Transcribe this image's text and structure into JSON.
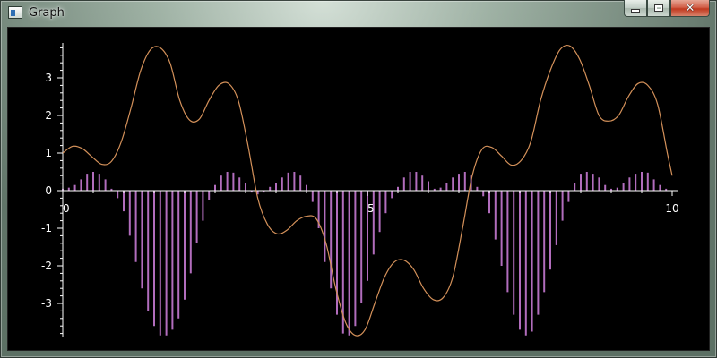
{
  "window": {
    "title": "Graph",
    "icon": "app-window-icon",
    "buttons": {
      "minimize": "minimize-icon",
      "maximize": "maximize-icon",
      "close": "close-icon"
    }
  },
  "colors": {
    "background": "#000000",
    "axis": "#ffffff",
    "line": "#d4915a",
    "bars": "#b26dbd"
  },
  "chart_data": {
    "type": "line",
    "title": "",
    "xlabel": "",
    "ylabel": "",
    "xlim": [
      0,
      10
    ],
    "ylim": [
      -3.9,
      3.9
    ],
    "x_ticks": [
      0,
      5,
      10
    ],
    "x_tick_labels": [
      "0",
      "5",
      "10"
    ],
    "y_ticks": [
      -3,
      -2,
      -1,
      0,
      1,
      2,
      3
    ],
    "y_tick_labels": [
      "-3",
      "-2",
      "-1",
      "0",
      "1",
      "2",
      "3"
    ],
    "grid": false,
    "legend": "none",
    "series": [
      {
        "type": "line",
        "x": [
          0,
          0.16,
          0.32,
          0.48,
          0.64,
          0.8,
          0.96,
          1.12,
          1.28,
          1.44,
          1.6,
          1.76,
          1.92,
          2.08,
          2.24,
          2.4,
          2.56,
          2.72,
          2.88,
          3.04,
          3.2,
          3.36,
          3.52,
          3.68,
          3.84,
          4.0,
          4.16,
          4.32,
          4.48,
          4.64,
          4.8,
          4.96,
          5.12,
          5.28,
          5.44,
          5.6,
          5.76,
          5.92,
          6.08,
          6.24,
          6.4,
          6.56,
          6.72,
          6.88,
          7.04,
          7.2,
          7.36,
          7.52,
          7.68,
          7.84,
          8.0,
          8.16,
          8.32,
          8.48,
          8.64,
          8.8,
          8.96,
          9.12,
          9.28,
          9.44,
          9.6,
          9.76,
          9.92,
          10.0
        ],
        "y": [
          1.0,
          1.18,
          1.12,
          0.9,
          0.7,
          0.78,
          1.3,
          2.2,
          3.2,
          3.75,
          3.8,
          3.4,
          2.4,
          1.88,
          1.9,
          2.4,
          2.8,
          2.85,
          2.4,
          1.2,
          -0.2,
          -0.9,
          -1.15,
          -1.05,
          -0.8,
          -0.68,
          -0.75,
          -1.4,
          -2.6,
          -3.5,
          -3.85,
          -3.7,
          -3.0,
          -2.3,
          -1.9,
          -1.85,
          -2.1,
          -2.6,
          -2.9,
          -2.85,
          -2.3,
          -1.0,
          0.4,
          1.1,
          1.15,
          0.92,
          0.68,
          0.8,
          1.3,
          2.4,
          3.2,
          3.75,
          3.85,
          3.5,
          2.8,
          2.0,
          1.85,
          2.0,
          2.5,
          2.85,
          2.8,
          2.3,
          1.0,
          0.4
        ]
      },
      {
        "type": "bar",
        "x": [
          0.0,
          0.1,
          0.2,
          0.3,
          0.4,
          0.5,
          0.6,
          0.7,
          0.8,
          0.9,
          1.0,
          1.1,
          1.2,
          1.3,
          1.4,
          1.5,
          1.6,
          1.7,
          1.8,
          1.9,
          2.0,
          2.1,
          2.2,
          2.3,
          2.4,
          2.5,
          2.6,
          2.7,
          2.8,
          2.9,
          3.0,
          3.1,
          3.2,
          3.3,
          3.4,
          3.5,
          3.6,
          3.7,
          3.8,
          3.9,
          4.0,
          4.1,
          4.2,
          4.3,
          4.4,
          4.5,
          4.6,
          4.7,
          4.8,
          4.9,
          5.0,
          5.1,
          5.2,
          5.3,
          5.4,
          5.5,
          5.6,
          5.7,
          5.8,
          5.9,
          6.0,
          6.1,
          6.2,
          6.3,
          6.4,
          6.5,
          6.6,
          6.7,
          6.8,
          6.9,
          7.0,
          7.1,
          7.2,
          7.3,
          7.4,
          7.5,
          7.6,
          7.7,
          7.8,
          7.9,
          8.0,
          8.1,
          8.2,
          8.3,
          8.4,
          8.5,
          8.6,
          8.7,
          8.8,
          8.9,
          9.0,
          9.1,
          9.2,
          9.3,
          9.4,
          9.5,
          9.6,
          9.7,
          9.8,
          9.9,
          10.0
        ],
        "y": [
          0.05,
          0.08,
          0.15,
          0.3,
          0.45,
          0.5,
          0.45,
          0.3,
          0.05,
          -0.2,
          -0.55,
          -1.2,
          -1.9,
          -2.6,
          -3.2,
          -3.6,
          -3.85,
          -3.85,
          -3.7,
          -3.4,
          -2.9,
          -2.2,
          -1.4,
          -0.8,
          -0.25,
          0.15,
          0.4,
          0.5,
          0.48,
          0.35,
          0.2,
          -0.05,
          -0.1,
          -0.05,
          0.1,
          0.2,
          0.35,
          0.48,
          0.5,
          0.4,
          0.15,
          -0.3,
          -1.0,
          -1.9,
          -2.6,
          -3.3,
          -3.8,
          -3.85,
          -3.6,
          -3.0,
          -2.4,
          -1.7,
          -1.1,
          -0.6,
          -0.2,
          0.1,
          0.35,
          0.5,
          0.5,
          0.4,
          0.25,
          0.05,
          0.08,
          0.2,
          0.35,
          0.45,
          0.5,
          0.4,
          0.1,
          -0.15,
          -0.6,
          -1.3,
          -2.0,
          -2.7,
          -3.3,
          -3.7,
          -3.85,
          -3.75,
          -3.3,
          -2.7,
          -2.1,
          -1.45,
          -0.8,
          -0.3,
          0.2,
          0.45,
          0.5,
          0.45,
          0.35,
          0.15,
          0.05,
          0.08,
          0.2,
          0.35,
          0.45,
          0.5,
          0.48,
          0.3,
          0.15,
          0.05,
          0.0
        ]
      }
    ]
  }
}
